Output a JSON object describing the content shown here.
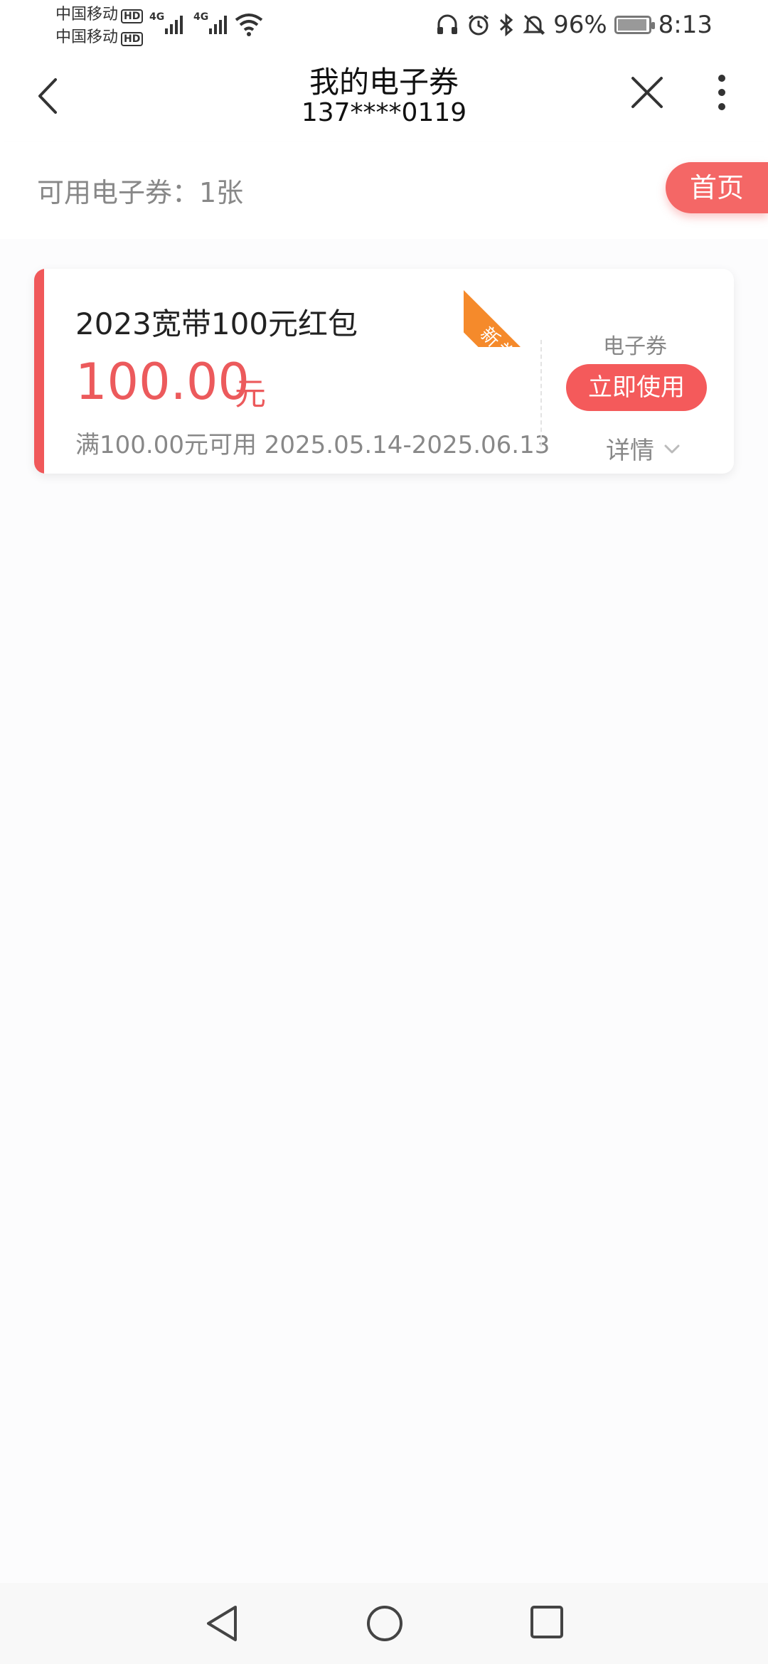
{
  "status_bar": {
    "carrier1": "中国移动",
    "carrier2": "中国移动",
    "hd": "HD",
    "network1": "4G",
    "network2": "4G",
    "battery_percent": "96%",
    "battery_level": 0.96,
    "time": "8:13"
  },
  "header": {
    "title": "我的电子券",
    "phone": "137****0119"
  },
  "summary": {
    "available_text": "可用电子券：1张",
    "home_button": "首页"
  },
  "coupon": {
    "title": "2023宽带100元红包",
    "amount": "100.00",
    "unit": "元",
    "condition": "满100.00元可用 2025.05.14-2025.06.13",
    "ribbon": "新券",
    "kind": "电子券",
    "use_button": "立即使用",
    "details": "详情"
  },
  "colors": {
    "accent_red": "#f45a5b",
    "ribbon_orange": "#f58a2b"
  }
}
